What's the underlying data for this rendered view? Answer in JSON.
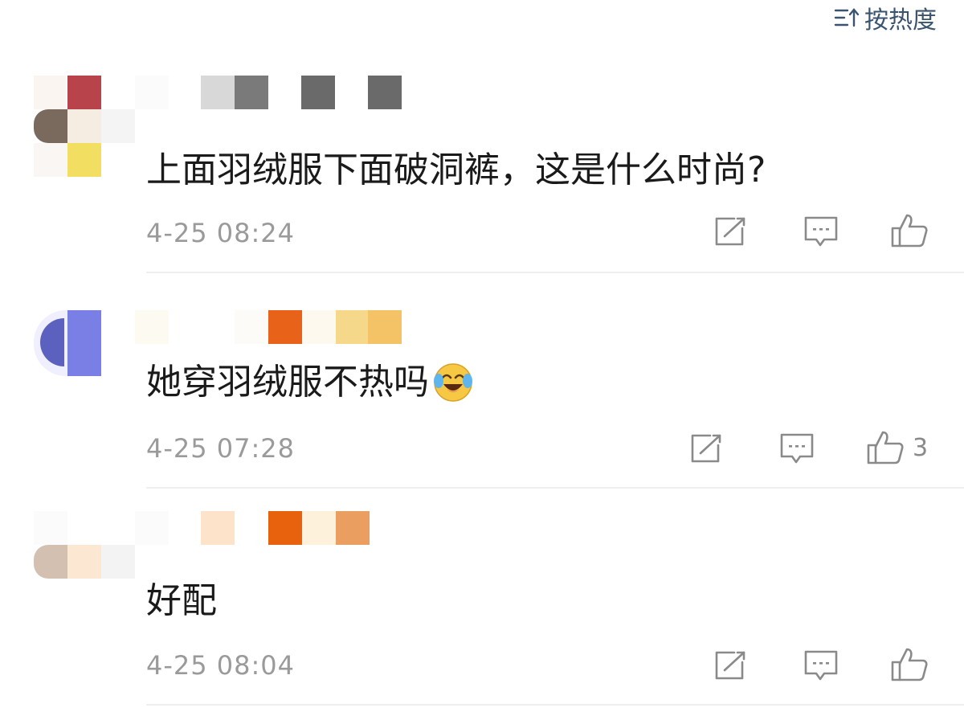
{
  "sort": {
    "icon": "sort-icon",
    "label": "按热度"
  },
  "comments": [
    {
      "text": "上面羽绒服下面破洞裤，这是什么时尚?",
      "time": "4-25 08:24",
      "like_count": ""
    },
    {
      "text": "她穿羽绒服不热吗",
      "emoji": "laughing-crying-emoji",
      "time": "4-25 07:28",
      "like_count": "3"
    },
    {
      "text": "好配",
      "time": "4-25 08:04",
      "like_count": ""
    }
  ],
  "icons": {
    "edit": "edit-icon",
    "reply": "comment-icon",
    "like": "thumbs-up-icon"
  },
  "colors": {
    "text": "#1a1a1a",
    "meta": "#9a9a9a",
    "icon": "#8a8a8a",
    "accent": "#3a5470"
  }
}
